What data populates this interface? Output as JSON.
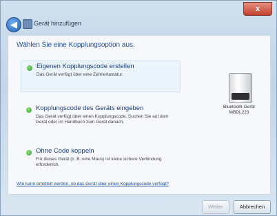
{
  "window": {
    "title": "Gerät hinzufügen",
    "close_label": "x",
    "back_label": "◀"
  },
  "content": {
    "heading": "Wählen Sie eine Kopplungsoption aus.",
    "options": [
      {
        "title": "Eigenen Kopplungscode erstellen",
        "description": "Das Gerät verfügt über eine Zehnertastatur."
      },
      {
        "title": "Kopplungscode des Geräts eingeben",
        "description": "Das Gerät verfügt über einen Kopplungscode. Suchen Sie auf dem Gerät oder im Handbuch zum Gerät danach."
      },
      {
        "title": "Ohne Code koppeln",
        "description": "Für dieses Gerät (z. B. eine Maus) ist keine sichere Verbindung erforderlich."
      }
    ],
    "device": {
      "label": "Bluetooth-Gerät MBDL223"
    },
    "help_link": "Wie kann ermittelt werden, ob das Gerät über einen Kopplungscode verfügt?"
  },
  "footer": {
    "next_label": "Weiter",
    "cancel_label": "Abbrechen"
  }
}
